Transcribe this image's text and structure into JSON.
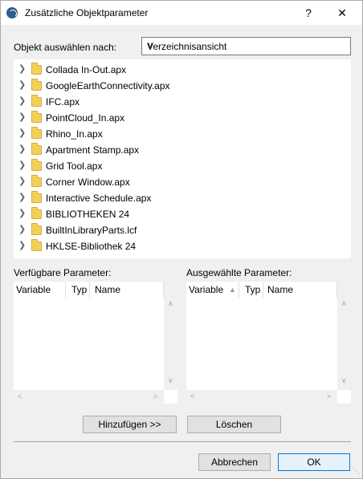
{
  "window": {
    "title": "Zusätzliche Objektparameter",
    "help": "?",
    "close": "✕"
  },
  "selector": {
    "label": "Objekt auswählen nach:",
    "value": "Verzeichnisansicht"
  },
  "tree": {
    "items": [
      {
        "label": "Collada In-Out.apx"
      },
      {
        "label": "GoogleEarthConnectivity.apx"
      },
      {
        "label": "IFC.apx"
      },
      {
        "label": "PointCloud_In.apx"
      },
      {
        "label": "Rhino_In.apx"
      },
      {
        "label": "Apartment Stamp.apx"
      },
      {
        "label": "Grid Tool.apx"
      },
      {
        "label": "Corner Window.apx"
      },
      {
        "label": "Interactive Schedule.apx"
      },
      {
        "label": "BIBLIOTHEKEN 24"
      },
      {
        "label": "BuiltInLibraryParts.lcf"
      },
      {
        "label": "HKLSE-Bibliothek 24"
      }
    ]
  },
  "available": {
    "label": "Verfügbare Parameter:",
    "columns": {
      "variable": "Variable",
      "type": "Typ",
      "name": "Name"
    }
  },
  "selected": {
    "label": "Ausgewählte Parameter:",
    "columns": {
      "variable": "Variable",
      "type": "Typ",
      "name": "Name"
    }
  },
  "buttons": {
    "add": "Hinzufügen >>",
    "delete": "Löschen",
    "cancel": "Abbrechen",
    "ok": "OK"
  },
  "colors": {
    "folder": "#f3cf5a",
    "ok_border": "#0078d7",
    "dialog_bg": "#f0f0f0"
  }
}
